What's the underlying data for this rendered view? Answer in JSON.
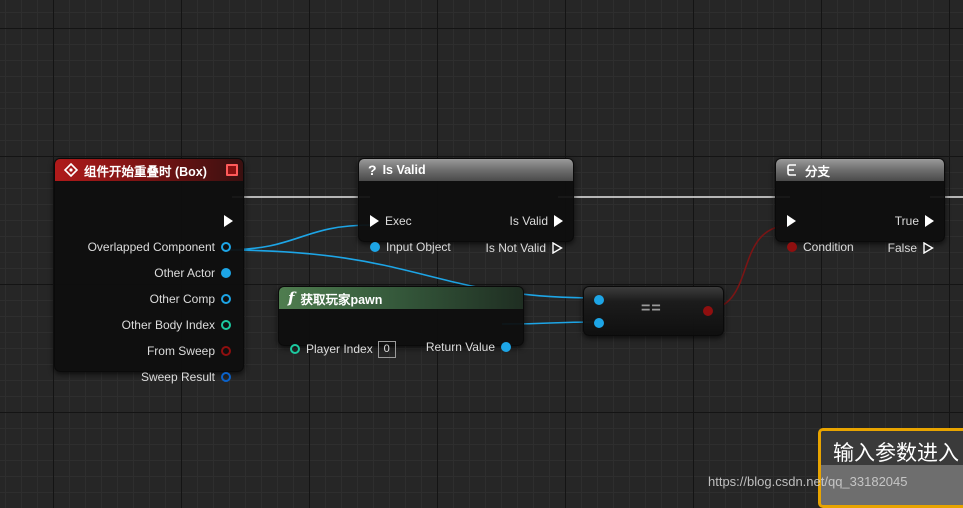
{
  "nodes": {
    "overlap_event": {
      "title": "组件开始重叠时 (Box)",
      "outputs": [
        "Overlapped Component",
        "Other Actor",
        "Other Comp",
        "Other Body Index",
        "From Sweep",
        "Sweep Result"
      ]
    },
    "is_valid": {
      "title": "Is Valid",
      "exec_in": "Exec",
      "input_object": "Input Object",
      "out_valid": "Is Valid",
      "out_not_valid": "Is Not Valid"
    },
    "get_pawn": {
      "title": "获取玩家pawn",
      "player_index_label": "Player Index",
      "player_index_value": "0",
      "return_value": "Return Value"
    },
    "compare": {
      "label": "=="
    },
    "branch": {
      "title": "分支",
      "condition": "Condition",
      "out_true": "True",
      "out_false": "False"
    }
  },
  "popup": {
    "title": "输入参数进入"
  },
  "watermark": "https://blog.csdn.net/qq_33182045",
  "colors": {
    "object_pin": "#1da5e6",
    "int_pin": "#1cc9a0",
    "bool_pin": "#8f0f0f",
    "struct_pin": "#0b62c9",
    "exec_wire": "#e6e6e6",
    "bool_wire": "#7a1515",
    "event_header": "#b01a1a",
    "func_header": "#4f7d4f",
    "popup_border": "#e8a400"
  }
}
